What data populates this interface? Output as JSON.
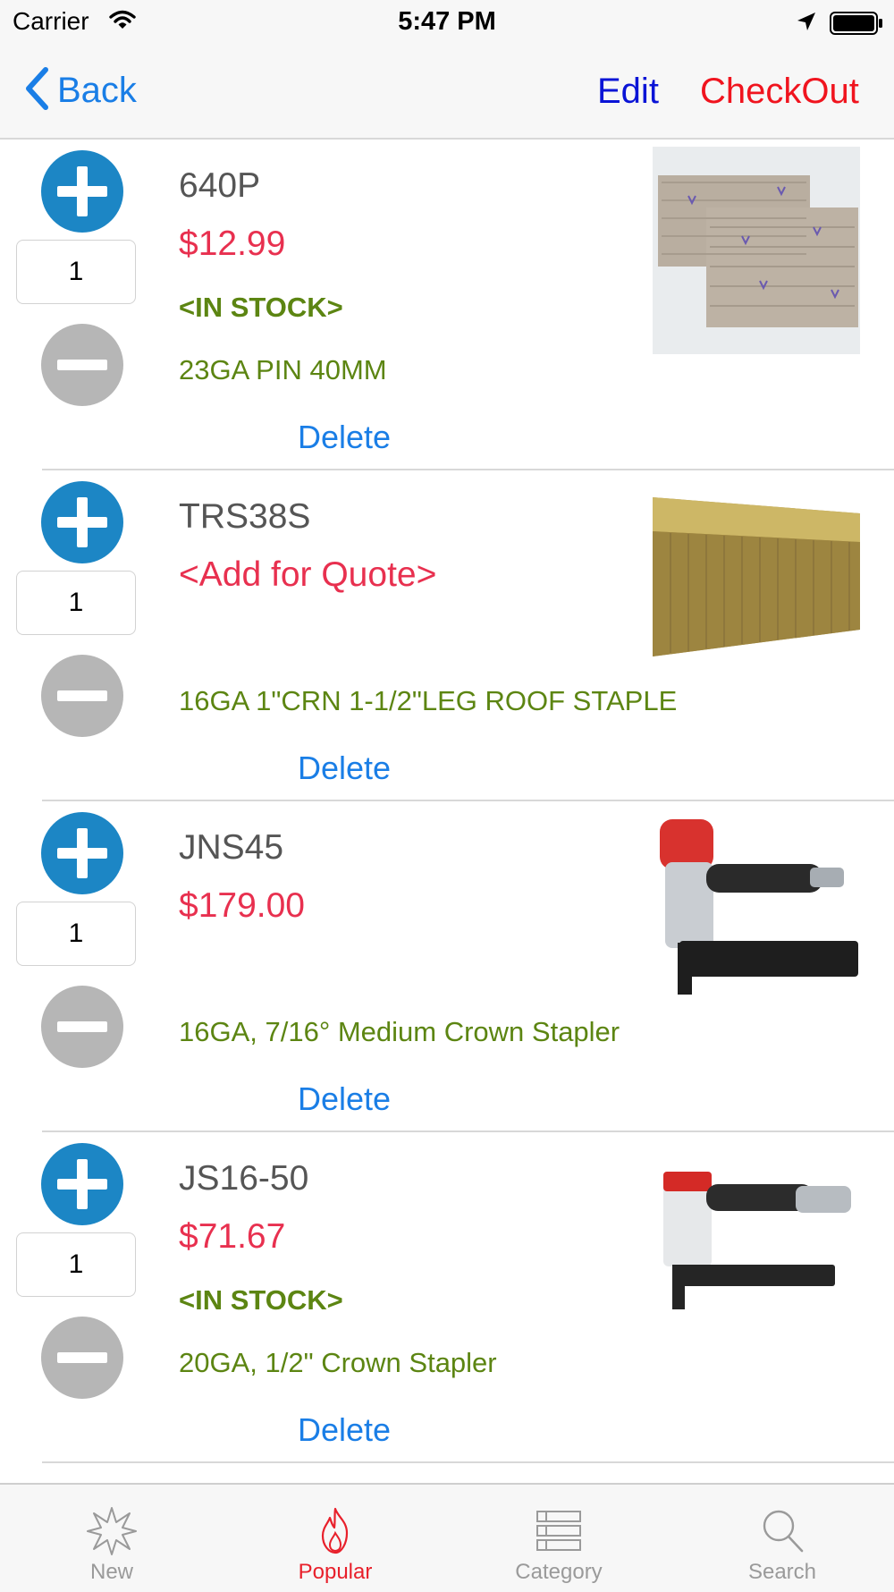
{
  "status_bar": {
    "carrier": "Carrier",
    "time": "5:47 PM"
  },
  "nav": {
    "back_label": "Back",
    "edit_label": "Edit",
    "checkout_label": "CheckOut"
  },
  "products": [
    {
      "name": "640P",
      "price": "$12.99",
      "stock": "<IN STOCK>",
      "description": "23GA PIN  40MM",
      "quantity": "1",
      "delete_label": "Delete"
    },
    {
      "name": "TRS38S",
      "price": "<Add for Quote>",
      "stock": "",
      "description": "16GA 1\"CRN 1-1/2\"LEG ROOF STAPLE",
      "quantity": "1",
      "delete_label": "Delete"
    },
    {
      "name": "JNS45",
      "price": "$179.00",
      "stock": "",
      "description": "16GA, 7/16° Medium Crown Stapler",
      "quantity": "1",
      "delete_label": "Delete"
    },
    {
      "name": "JS16-50",
      "price": "$71.67",
      "stock": "<IN STOCK>",
      "description": "20GA, 1/2\" Crown Stapler",
      "quantity": "1",
      "delete_label": "Delete"
    }
  ],
  "tab_bar": {
    "tabs": [
      {
        "label": "New",
        "icon": "starburst-icon",
        "active": false
      },
      {
        "label": "Popular",
        "icon": "flame-icon",
        "active": true
      },
      {
        "label": "Category",
        "icon": "list-icon",
        "active": false
      },
      {
        "label": "Search",
        "icon": "search-icon",
        "active": false
      }
    ]
  },
  "colors": {
    "accent_blue": "#1a7ee6",
    "checkout_red": "#f0141e",
    "price_red": "#e8304f",
    "stock_green": "#5c8512",
    "plus_blue": "#1c86c5",
    "minus_gray": "#b6b6b6",
    "tab_active": "#e8202b"
  }
}
